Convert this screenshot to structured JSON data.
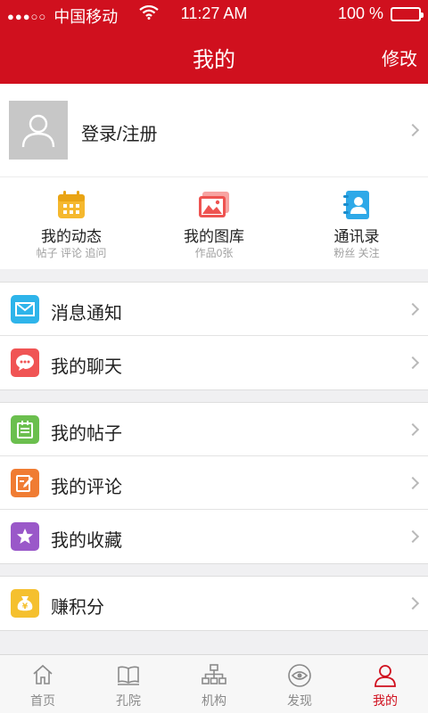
{
  "status_bar": {
    "signal_dots": "●●●○○",
    "carrier": "中国移动",
    "time": "11:27 AM",
    "battery": "100 %"
  },
  "navbar": {
    "title": "我的",
    "action": "修改"
  },
  "profile": {
    "login_label": "登录/注册"
  },
  "quick_links": [
    {
      "title": "我的动态",
      "subtitle": "帖子 评论 追问",
      "icon": "calendar-icon",
      "color": "#f5b82e"
    },
    {
      "title": "我的图库",
      "subtitle": "作品0张",
      "icon": "gallery-icon",
      "color": "#ee5350"
    },
    {
      "title": "通讯录",
      "subtitle": "粉丝 关注",
      "icon": "contacts-icon",
      "color": "#2ea9e8"
    }
  ],
  "sections": [
    [
      {
        "label": "消息通知",
        "icon": "mail-icon",
        "color": "#2eb4ea"
      },
      {
        "label": "我的聊天",
        "icon": "chat-icon",
        "color": "#f05454"
      }
    ],
    [
      {
        "label": "我的帖子",
        "icon": "post-icon",
        "color": "#6bbf4e"
      },
      {
        "label": "我的评论",
        "icon": "comment-edit-icon",
        "color": "#f07c33"
      },
      {
        "label": "我的收藏",
        "icon": "star-icon",
        "color": "#9a58c9"
      }
    ],
    [
      {
        "label": "赚积分",
        "icon": "money-bag-icon",
        "color": "#f5c02e"
      }
    ]
  ],
  "tabbar": {
    "tabs": [
      {
        "label": "首页",
        "icon": "home-icon"
      },
      {
        "label": "孔院",
        "icon": "book-icon"
      },
      {
        "label": "机构",
        "icon": "org-chart-icon"
      },
      {
        "label": "发现",
        "icon": "eye-icon"
      },
      {
        "label": "我的",
        "icon": "user-icon",
        "active": true
      }
    ],
    "accent_color": "#d0101e"
  },
  "brand_color": "#d0101e"
}
